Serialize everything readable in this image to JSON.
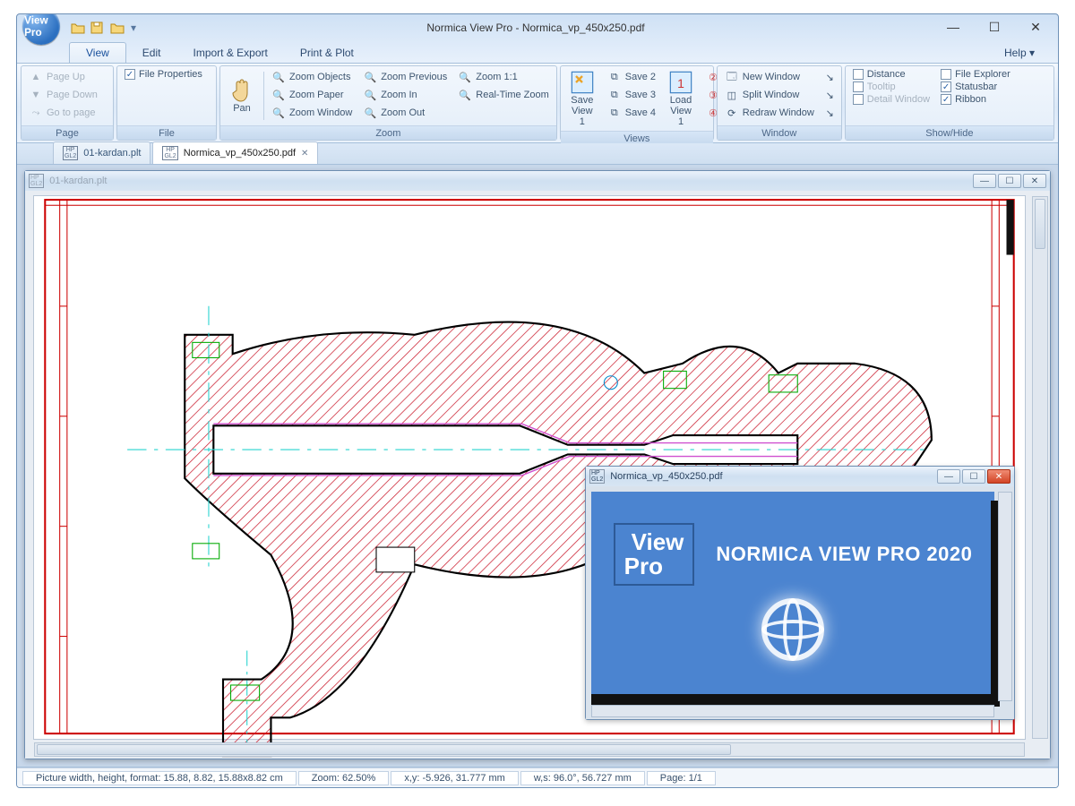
{
  "app": {
    "title": "Normica View Pro - Normica_vp_450x250.pdf",
    "orb_label": "View Pro"
  },
  "ribbon_tabs": {
    "view": "View",
    "edit": "Edit",
    "import_export": "Import & Export",
    "print_plot": "Print & Plot",
    "help": "Help ▾"
  },
  "page_panel": {
    "label": "Page",
    "page_up": "Page Up",
    "page_down": "Page Down",
    "go_to": "Go to page"
  },
  "file_panel": {
    "label": "File",
    "file_properties": "File Properties"
  },
  "zoom_panel": {
    "label": "Zoom",
    "pan": "Pan",
    "zoom_objects": "Zoom Objects",
    "zoom_paper": "Zoom Paper",
    "zoom_window": "Zoom Window",
    "zoom_previous": "Zoom Previous",
    "zoom_in": "Zoom In",
    "zoom_out": "Zoom Out",
    "zoom_11": "Zoom 1:1",
    "real_time": "Real-Time Zoom"
  },
  "views_panel": {
    "label": "Views",
    "save_view": "Save View 1",
    "save2": "Save 2",
    "save3": "Save 3",
    "save4": "Save 4",
    "load_view": "Load View 1"
  },
  "window_panel": {
    "label": "Window",
    "new": "New Window",
    "split": "Split Window",
    "redraw": "Redraw Window"
  },
  "showhide_panel": {
    "label": "Show/Hide",
    "distance": "Distance",
    "tooltip": "Tooltip",
    "detail_window": "Detail Window",
    "file_explorer": "File Explorer",
    "statusbar": "Statusbar",
    "ribbon": "Ribbon"
  },
  "doc_tabs": {
    "tab1": "01-kardan.plt",
    "tab2": "Normica_vp_450x250.pdf"
  },
  "mdi1": {
    "title": "01-kardan.plt"
  },
  "mdi2": {
    "title": "Normica_vp_450x250.pdf",
    "logo_l1": "View",
    "logo_l2": "Pro",
    "product_name": "NORMICA VIEW PRO 2020"
  },
  "status": {
    "picture": "Picture width, height, format: 15.88, 8.82, 15.88x8.82 cm",
    "zoom": "Zoom: 62.50%",
    "xy": "x,y: -5.926, 31.777 mm",
    "ws": "w,s: 96.0°, 56.727 mm",
    "page": "Page: 1/1"
  }
}
